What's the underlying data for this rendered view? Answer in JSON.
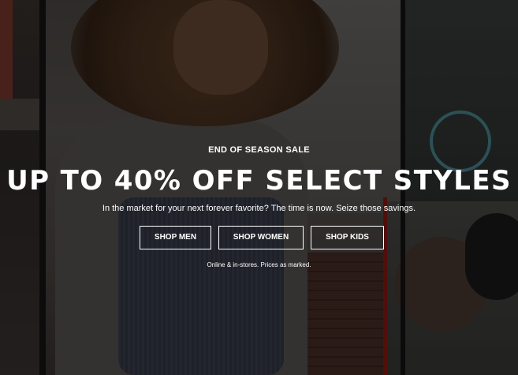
{
  "hero": {
    "eyebrow": "END OF SEASON SALE",
    "headline": "UP TO 40% OFF SELECT STYLES",
    "subtext": "In the market for your next forever favorite? The time is now. Seize those savings.",
    "buttons": {
      "men": "SHOP MEN",
      "women": "SHOP WOMEN",
      "kids": "SHOP KIDS"
    },
    "disclaimer": "Online & in-stores. Prices as marked."
  },
  "colors": {
    "text": "#ffffff",
    "overlay": "#000000",
    "accent_red": "#8a1a12"
  }
}
